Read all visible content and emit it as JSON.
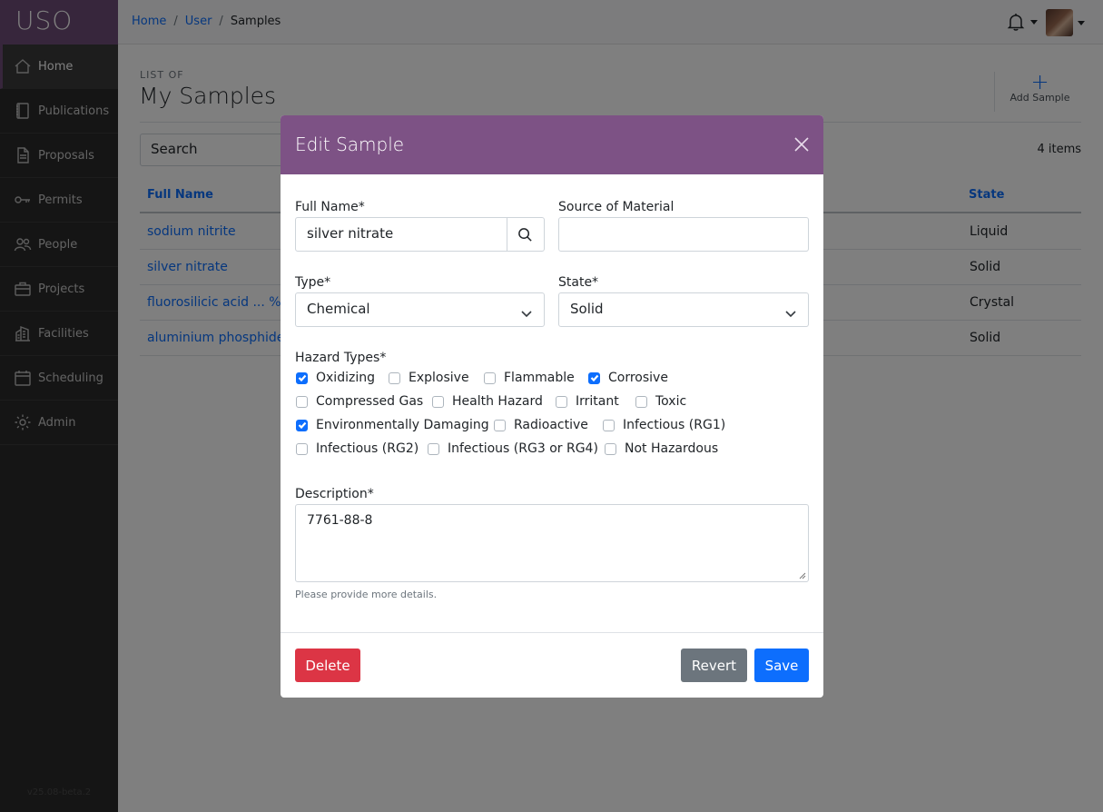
{
  "sidebar": {
    "brand": "USO",
    "items": [
      {
        "label": "Home",
        "icon": "home-icon"
      },
      {
        "label": "Publications",
        "icon": "book-icon"
      },
      {
        "label": "Proposals",
        "icon": "document-icon"
      },
      {
        "label": "Permits",
        "icon": "key-icon"
      },
      {
        "label": "People",
        "icon": "people-icon"
      },
      {
        "label": "Projects",
        "icon": "briefcase-icon"
      },
      {
        "label": "Facilities",
        "icon": "building-icon"
      },
      {
        "label": "Scheduling",
        "icon": "calendar-icon"
      },
      {
        "label": "Admin",
        "icon": "gear-icon"
      }
    ],
    "version": "v25.08-beta.2"
  },
  "topbar": {
    "breadcrumb": {
      "home": "Home",
      "user": "User",
      "current": "Samples"
    }
  },
  "main": {
    "list_of": "LIST OF",
    "title": "My Samples",
    "add_label": "Add Sample",
    "search_placeholder": "Search",
    "item_count": "4 items",
    "columns": {
      "name": "Full Name",
      "state": "State"
    },
    "rows": [
      {
        "name": "sodium nitrite",
        "state": "Liquid"
      },
      {
        "name": "silver nitrate",
        "state": "Solid"
      },
      {
        "name": "fluorosilicic acid ... %",
        "state": "Crystal"
      },
      {
        "name": "aluminium phosphide",
        "state": "Solid"
      }
    ]
  },
  "modal": {
    "title": "Edit Sample",
    "full_name_label": "Full Name*",
    "full_name_value": "silver nitrate",
    "source_label": "Source of Material",
    "source_value": "",
    "type_label": "Type*",
    "type_value": "Chemical",
    "state_label": "State*",
    "state_value": "Solid",
    "hazard_label": "Hazard Types*",
    "hazards": [
      {
        "label": "Oxidizing",
        "checked": true
      },
      {
        "label": "Explosive",
        "checked": false
      },
      {
        "label": "Flammable",
        "checked": false
      },
      {
        "label": "Corrosive",
        "checked": true
      },
      {
        "label": "Compressed Gas",
        "checked": false
      },
      {
        "label": "Health Hazard",
        "checked": false
      },
      {
        "label": "Irritant",
        "checked": false
      },
      {
        "label": "Toxic",
        "checked": false
      },
      {
        "label": "Environmentally Damaging",
        "checked": true
      },
      {
        "label": "Radioactive",
        "checked": false
      },
      {
        "label": "Infectious (RG1)",
        "checked": false
      },
      {
        "label": "Infectious (RG2)",
        "checked": false
      },
      {
        "label": "Infectious (RG3 or RG4)",
        "checked": false
      },
      {
        "label": "Not Hazardous",
        "checked": false
      }
    ],
    "description_label": "Description*",
    "description_value": "7761-88-8",
    "help_text": "Please provide more details.",
    "delete_label": "Delete",
    "revert_label": "Revert",
    "save_label": "Save"
  }
}
